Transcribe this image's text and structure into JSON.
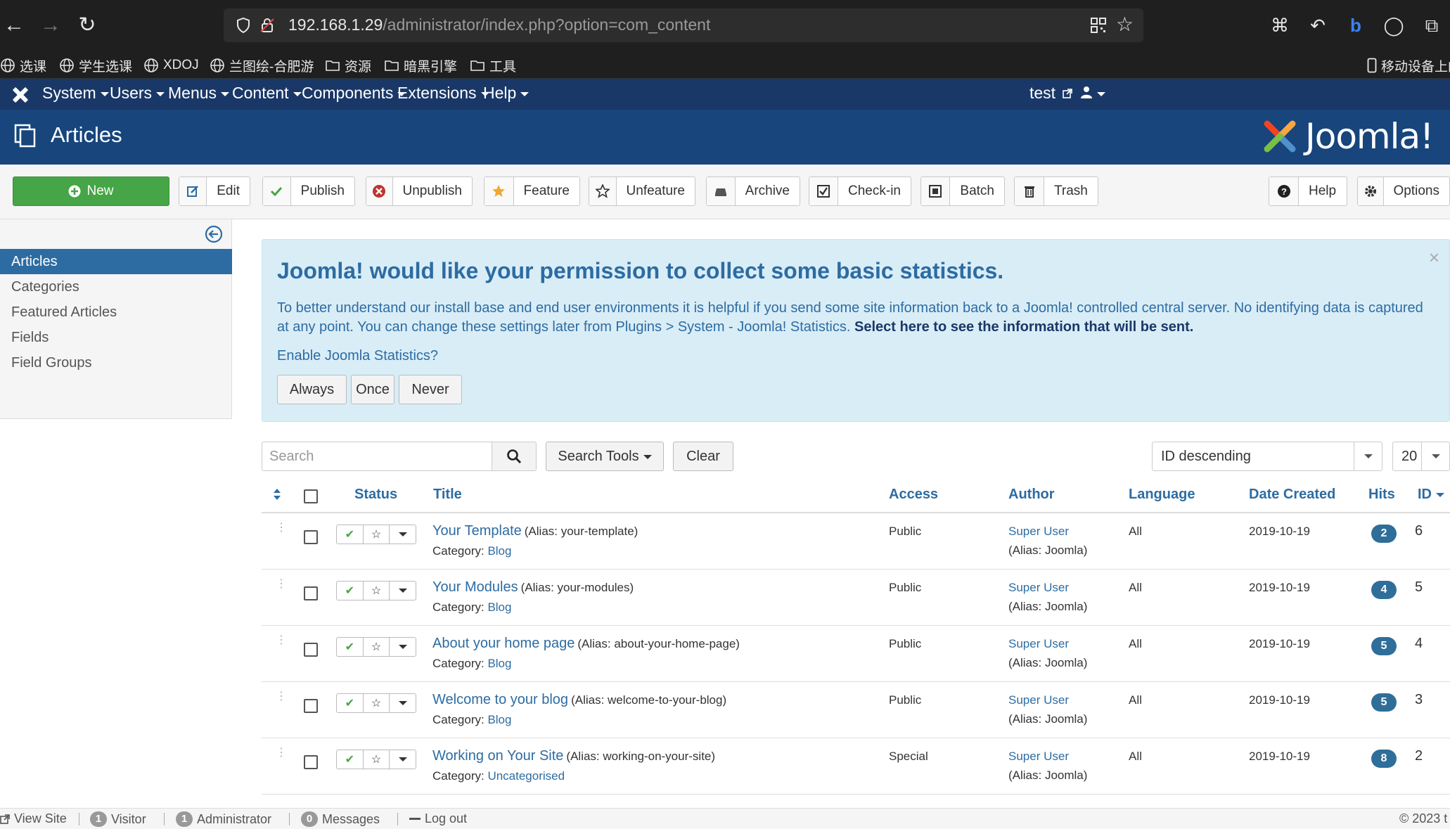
{
  "browser": {
    "url_host": "192.168.1.29",
    "url_path": "/administrator/index.php?option=com_content",
    "bookmarks": [
      "选课",
      "学生选课",
      "XDOJ",
      "兰图绘-合肥游",
      "资源",
      "暗黑引擎",
      "工具"
    ],
    "mobile_bookmarks": "移动设备上的"
  },
  "navbar": {
    "items": [
      "System",
      "Users",
      "Menus",
      "Content",
      "Components",
      "Extensions",
      "Help"
    ],
    "site_link": "test"
  },
  "subhead": {
    "title": "Articles",
    "logo_text": "Joomla!"
  },
  "toolbar": {
    "new": "New",
    "edit": "Edit",
    "publish": "Publish",
    "unpublish": "Unpublish",
    "feature": "Feature",
    "unfeature": "Unfeature",
    "archive": "Archive",
    "checkin": "Check-in",
    "batch": "Batch",
    "trash": "Trash",
    "help": "Help",
    "options": "Options"
  },
  "sidebar": {
    "items": [
      {
        "label": "Articles",
        "active": true
      },
      {
        "label": "Categories"
      },
      {
        "label": "Featured Articles"
      },
      {
        "label": "Fields"
      },
      {
        "label": "Field Groups"
      }
    ]
  },
  "stats": {
    "title": "Joomla! would like your permission to collect some basic statistics.",
    "body": "To better understand our install base and end user environments it is helpful if you send some site information back to a Joomla! controlled central server. No identifying data is captured at any point. You can change these settings later from Plugins > System - Joomla! Statistics.",
    "body_link": "Select here to see the information that will be sent.",
    "question": "Enable Joomla Statistics?",
    "always": "Always",
    "once": "Once",
    "never": "Never"
  },
  "filters": {
    "search_placeholder": "Search",
    "search_tools": "Search Tools",
    "clear": "Clear",
    "ordering": "ID descending",
    "limit": "20"
  },
  "table": {
    "headers": {
      "status": "Status",
      "title": "Title",
      "access": "Access",
      "author": "Author",
      "language": "Language",
      "date": "Date Created",
      "hits": "Hits",
      "id": "ID"
    },
    "rows": [
      {
        "title": "Your Template",
        "alias": "(Alias: your-template)",
        "category_label": "Category:",
        "category": "Blog",
        "access": "Public",
        "author": "Super User",
        "author_alias": "(Alias: Joomla)",
        "language": "All",
        "date": "2019-10-19",
        "hits": "2",
        "id": "6"
      },
      {
        "title": "Your Modules",
        "alias": "(Alias: your-modules)",
        "category_label": "Category:",
        "category": "Blog",
        "access": "Public",
        "author": "Super User",
        "author_alias": "(Alias: Joomla)",
        "language": "All",
        "date": "2019-10-19",
        "hits": "4",
        "id": "5"
      },
      {
        "title": "About your home page",
        "alias": "(Alias: about-your-home-page)",
        "category_label": "Category:",
        "category": "Blog",
        "access": "Public",
        "author": "Super User",
        "author_alias": "(Alias: Joomla)",
        "language": "All",
        "date": "2019-10-19",
        "hits": "5",
        "id": "4"
      },
      {
        "title": "Welcome to your blog",
        "alias": "(Alias: welcome-to-your-blog)",
        "category_label": "Category:",
        "category": "Blog",
        "access": "Public",
        "author": "Super User",
        "author_alias": "(Alias: Joomla)",
        "language": "All",
        "date": "2019-10-19",
        "hits": "5",
        "id": "3"
      },
      {
        "title": "Working on Your Site",
        "alias": "(Alias: working-on-your-site)",
        "category_label": "Category:",
        "category": "Uncategorised",
        "access": "Special",
        "author": "Super User",
        "author_alias": "(Alias: Joomla)",
        "language": "All",
        "date": "2019-10-19",
        "hits": "8",
        "id": "2"
      }
    ]
  },
  "footer": {
    "view_site": "View Site",
    "visitor_count": "1",
    "visitor": "Visitor",
    "admin_count": "1",
    "admin": "Administrator",
    "messages_count": "0",
    "messages": "Messages",
    "logout": "Log out",
    "copyright": "© 2023 t"
  },
  "colors": {
    "navbar": "#1a3867",
    "subhead": "#17457c",
    "new_button": "#46a546",
    "link": "#2d6ca2",
    "alert_bg": "#d9edf7",
    "hits_badge": "#2f6e99",
    "publish_check": "#46a546"
  }
}
